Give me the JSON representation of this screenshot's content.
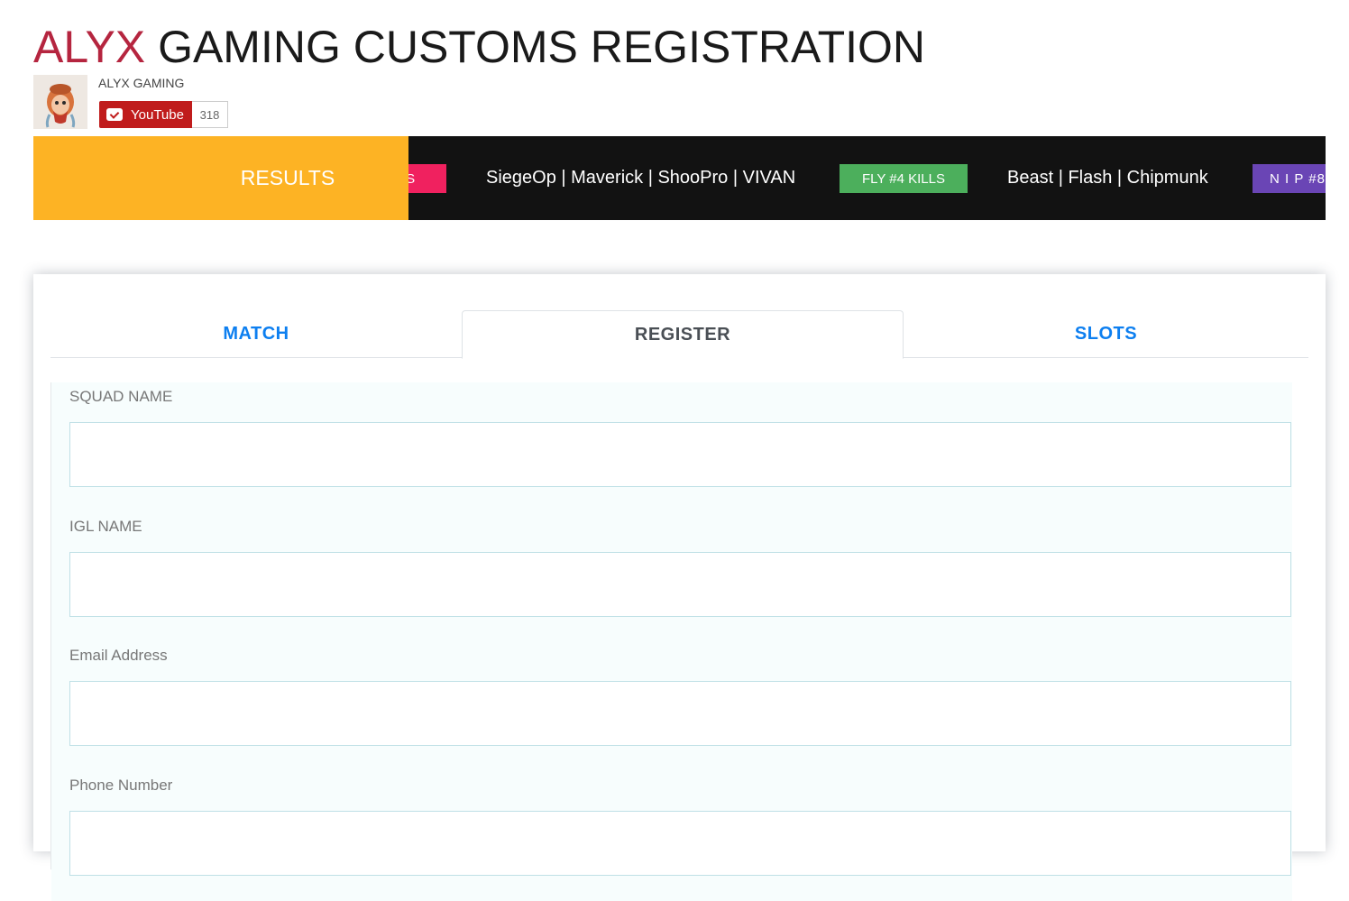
{
  "header": {
    "title_accent": "ALYX",
    "title_rest": "GAMING CUSTOMS REGISTRATION",
    "channel_name": "ALYX GAMING",
    "subscribe_label": "YouTube",
    "subscriber_count": "318"
  },
  "ticker": {
    "results_label": "RESULTS",
    "items": [
      {
        "type": "badge",
        "text": "LS",
        "color": "#f0215f"
      },
      {
        "type": "text",
        "text": "SiegeOp | Maverick | ShooPro | VIVAN"
      },
      {
        "type": "badge",
        "text": "FLY #4 KILLS",
        "color": "#4caf5c"
      },
      {
        "type": "text",
        "text": "Beast | Flash | Chipmunk"
      },
      {
        "type": "badge",
        "text": "N I P #8",
        "color": "#6a45b5"
      }
    ]
  },
  "tabs": [
    {
      "label": "MATCH",
      "active": false
    },
    {
      "label": "REGISTER",
      "active": true
    },
    {
      "label": "SLOTS",
      "active": false
    }
  ],
  "form": {
    "fields": [
      {
        "label": "SQUAD NAME",
        "value": "",
        "placeholder": ""
      },
      {
        "label": "IGL NAME",
        "value": "",
        "placeholder": ""
      },
      {
        "label": "Email Address",
        "value": "",
        "placeholder": ""
      },
      {
        "label": "Phone Number",
        "value": "",
        "placeholder": ""
      }
    ]
  },
  "colors": {
    "accent_red": "#b5253f",
    "results_yellow": "#fdb324",
    "tab_blue": "#0d7ff0",
    "ticker_bg": "#121212"
  }
}
